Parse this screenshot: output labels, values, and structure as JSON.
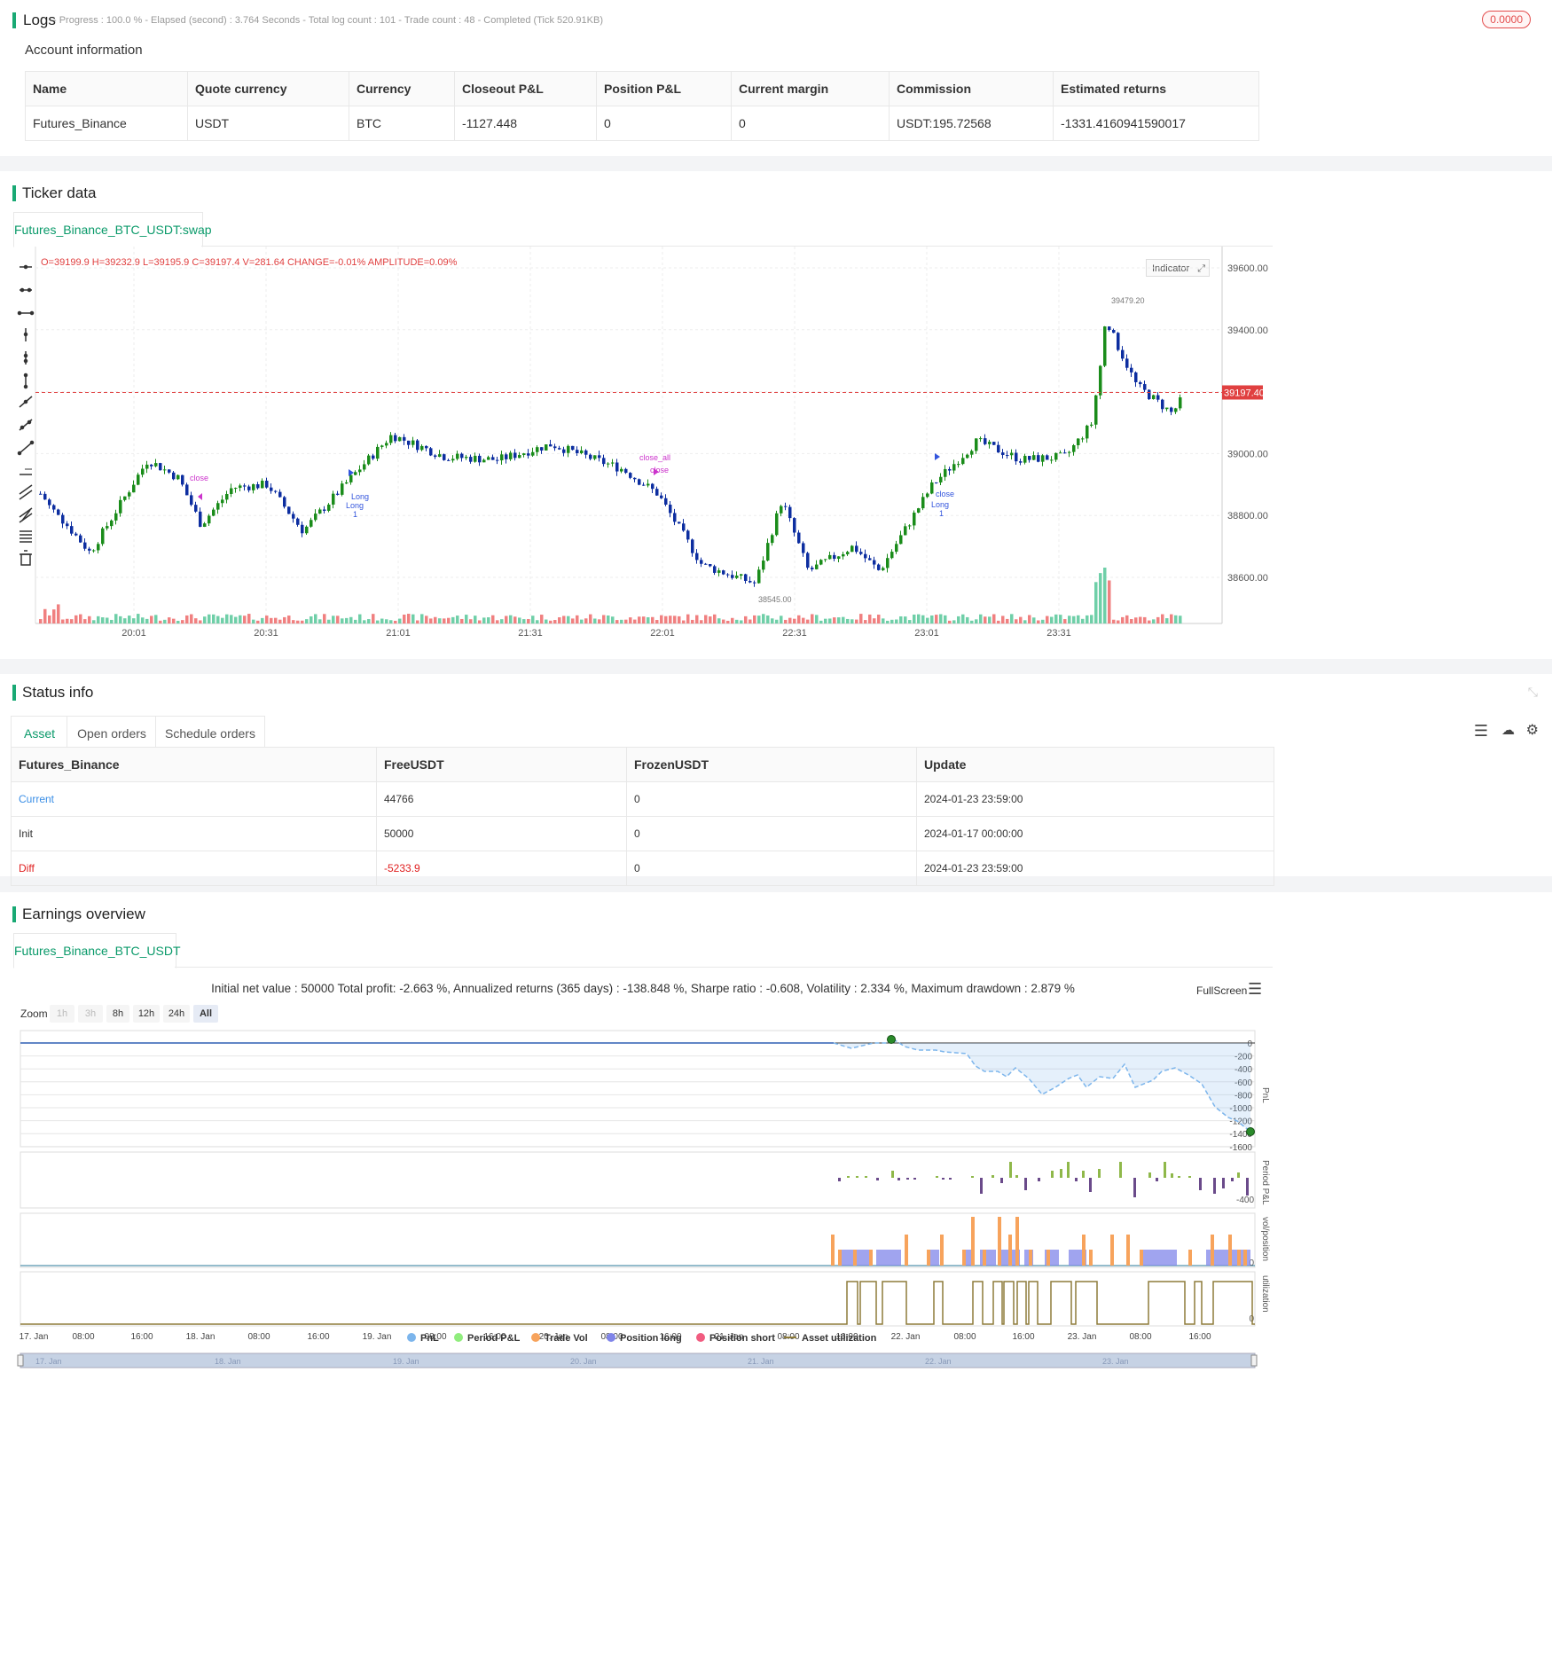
{
  "logs": {
    "title": "Logs",
    "summary": "- Progress : 100.0 % - Elapsed (second) : 3.764  Seconds - Total log count : 101 - Trade count : 48 - Completed (Tick 520.91KB)",
    "badge": "0.0000"
  },
  "account": {
    "title": "Account information",
    "headers": [
      "Name",
      "Quote currency",
      "Currency",
      "Closeout P&L",
      "Position P&L",
      "Current margin",
      "Commission",
      "Estimated returns"
    ],
    "row": [
      "Futures_Binance",
      "USDT",
      "BTC",
      "-1127.448",
      "0",
      "0",
      "USDT:195.72568",
      "-1331.4160941590017"
    ]
  },
  "ticker": {
    "title": "Ticker data",
    "tab": "Futures_Binance_BTC_USDT:swap",
    "ohlc": "O=39199.9 H=39232.9 L=39195.9 C=39197.4 V=281.64 CHANGE=-0.01% AMPLITUDE=0.09%",
    "indicator_button": "Indicator",
    "last_price": "39197.40",
    "high_label": "39479.20",
    "low_label": "38545.00",
    "y_ticks": [
      "39600.00",
      "39400.00",
      "39200.00",
      "39000.00",
      "38800.00",
      "38600.00"
    ],
    "x_ticks": [
      "20:01",
      "20:31",
      "21:01",
      "21:31",
      "22:01",
      "22:31",
      "23:01",
      "23:31"
    ],
    "markers": [
      "close_all",
      "close",
      "Long",
      "1",
      "close",
      "Long",
      "1",
      "Long",
      "1",
      "close"
    ]
  },
  "status": {
    "title": "Status info",
    "tabs": [
      "Asset",
      "Open orders",
      "Schedule orders"
    ],
    "headers": [
      "Futures_Binance",
      "FreeUSDT",
      "FrozenUSDT",
      "Update"
    ],
    "rows": [
      [
        "Current",
        "44766",
        "0",
        "2024-01-23 23:59:00"
      ],
      [
        "Init",
        "50000",
        "0",
        "2024-01-17 00:00:00"
      ],
      [
        "Diff",
        "-5233.9",
        "0",
        "2024-01-23 23:59:00"
      ]
    ]
  },
  "earnings": {
    "title": "Earnings overview",
    "tab": "Futures_Binance_BTC_USDT",
    "summary": "Initial net value : 50000 Total profit: -2.663 %, Annualized returns (365 days) : -138.848 %, Sharpe ratio : -0.608, Volatility : 2.334 %, Maximum drawdown : 2.879 %",
    "fullscreen": "FullScreen",
    "zoom_label": "Zoom",
    "zoom_options": [
      "1h",
      "3h",
      "8h",
      "12h",
      "24h",
      "All"
    ],
    "pnl_ticks": [
      "0",
      "-200",
      "-400",
      "-600",
      "-800",
      "-1000",
      "-1200",
      "-1400",
      "-1600"
    ],
    "period_tick": "-400",
    "panel_labels": [
      "PnL",
      "Period P&L",
      "vol/position",
      "utilization"
    ],
    "zero_labels": [
      "0",
      "0"
    ],
    "x_ticks": [
      "17. Jan",
      "08:00",
      "16:00",
      "18. Jan",
      "08:00",
      "16:00",
      "19. Jan",
      "08:00",
      "16:00",
      "20. Jan",
      "08:00",
      "16:00",
      "21. Jan",
      "08:00",
      "16:00",
      "22. Jan",
      "08:00",
      "16:00",
      "23. Jan",
      "08:00",
      "16:00"
    ],
    "nav_ticks": [
      "17. Jan",
      "18. Jan",
      "19. Jan",
      "20. Jan",
      "21. Jan",
      "22. Jan",
      "23. Jan"
    ],
    "legend": [
      {
        "label": "PnL",
        "color": "#7cb5ec"
      },
      {
        "label": "Period P&L",
        "color": "#90ed7d"
      },
      {
        "label": "Trade Vol",
        "color": "#f7a35c"
      },
      {
        "label": "Position long",
        "color": "#8085e9"
      },
      {
        "label": "Position short",
        "color": "#f15c80"
      },
      {
        "label": "Asset utilization",
        "color": "#8d7b3a"
      }
    ]
  },
  "colors": {
    "accent": "#19a974",
    "up": "#1a8c1a",
    "down": "#0d2ea0",
    "price_line": "#e04040"
  }
}
